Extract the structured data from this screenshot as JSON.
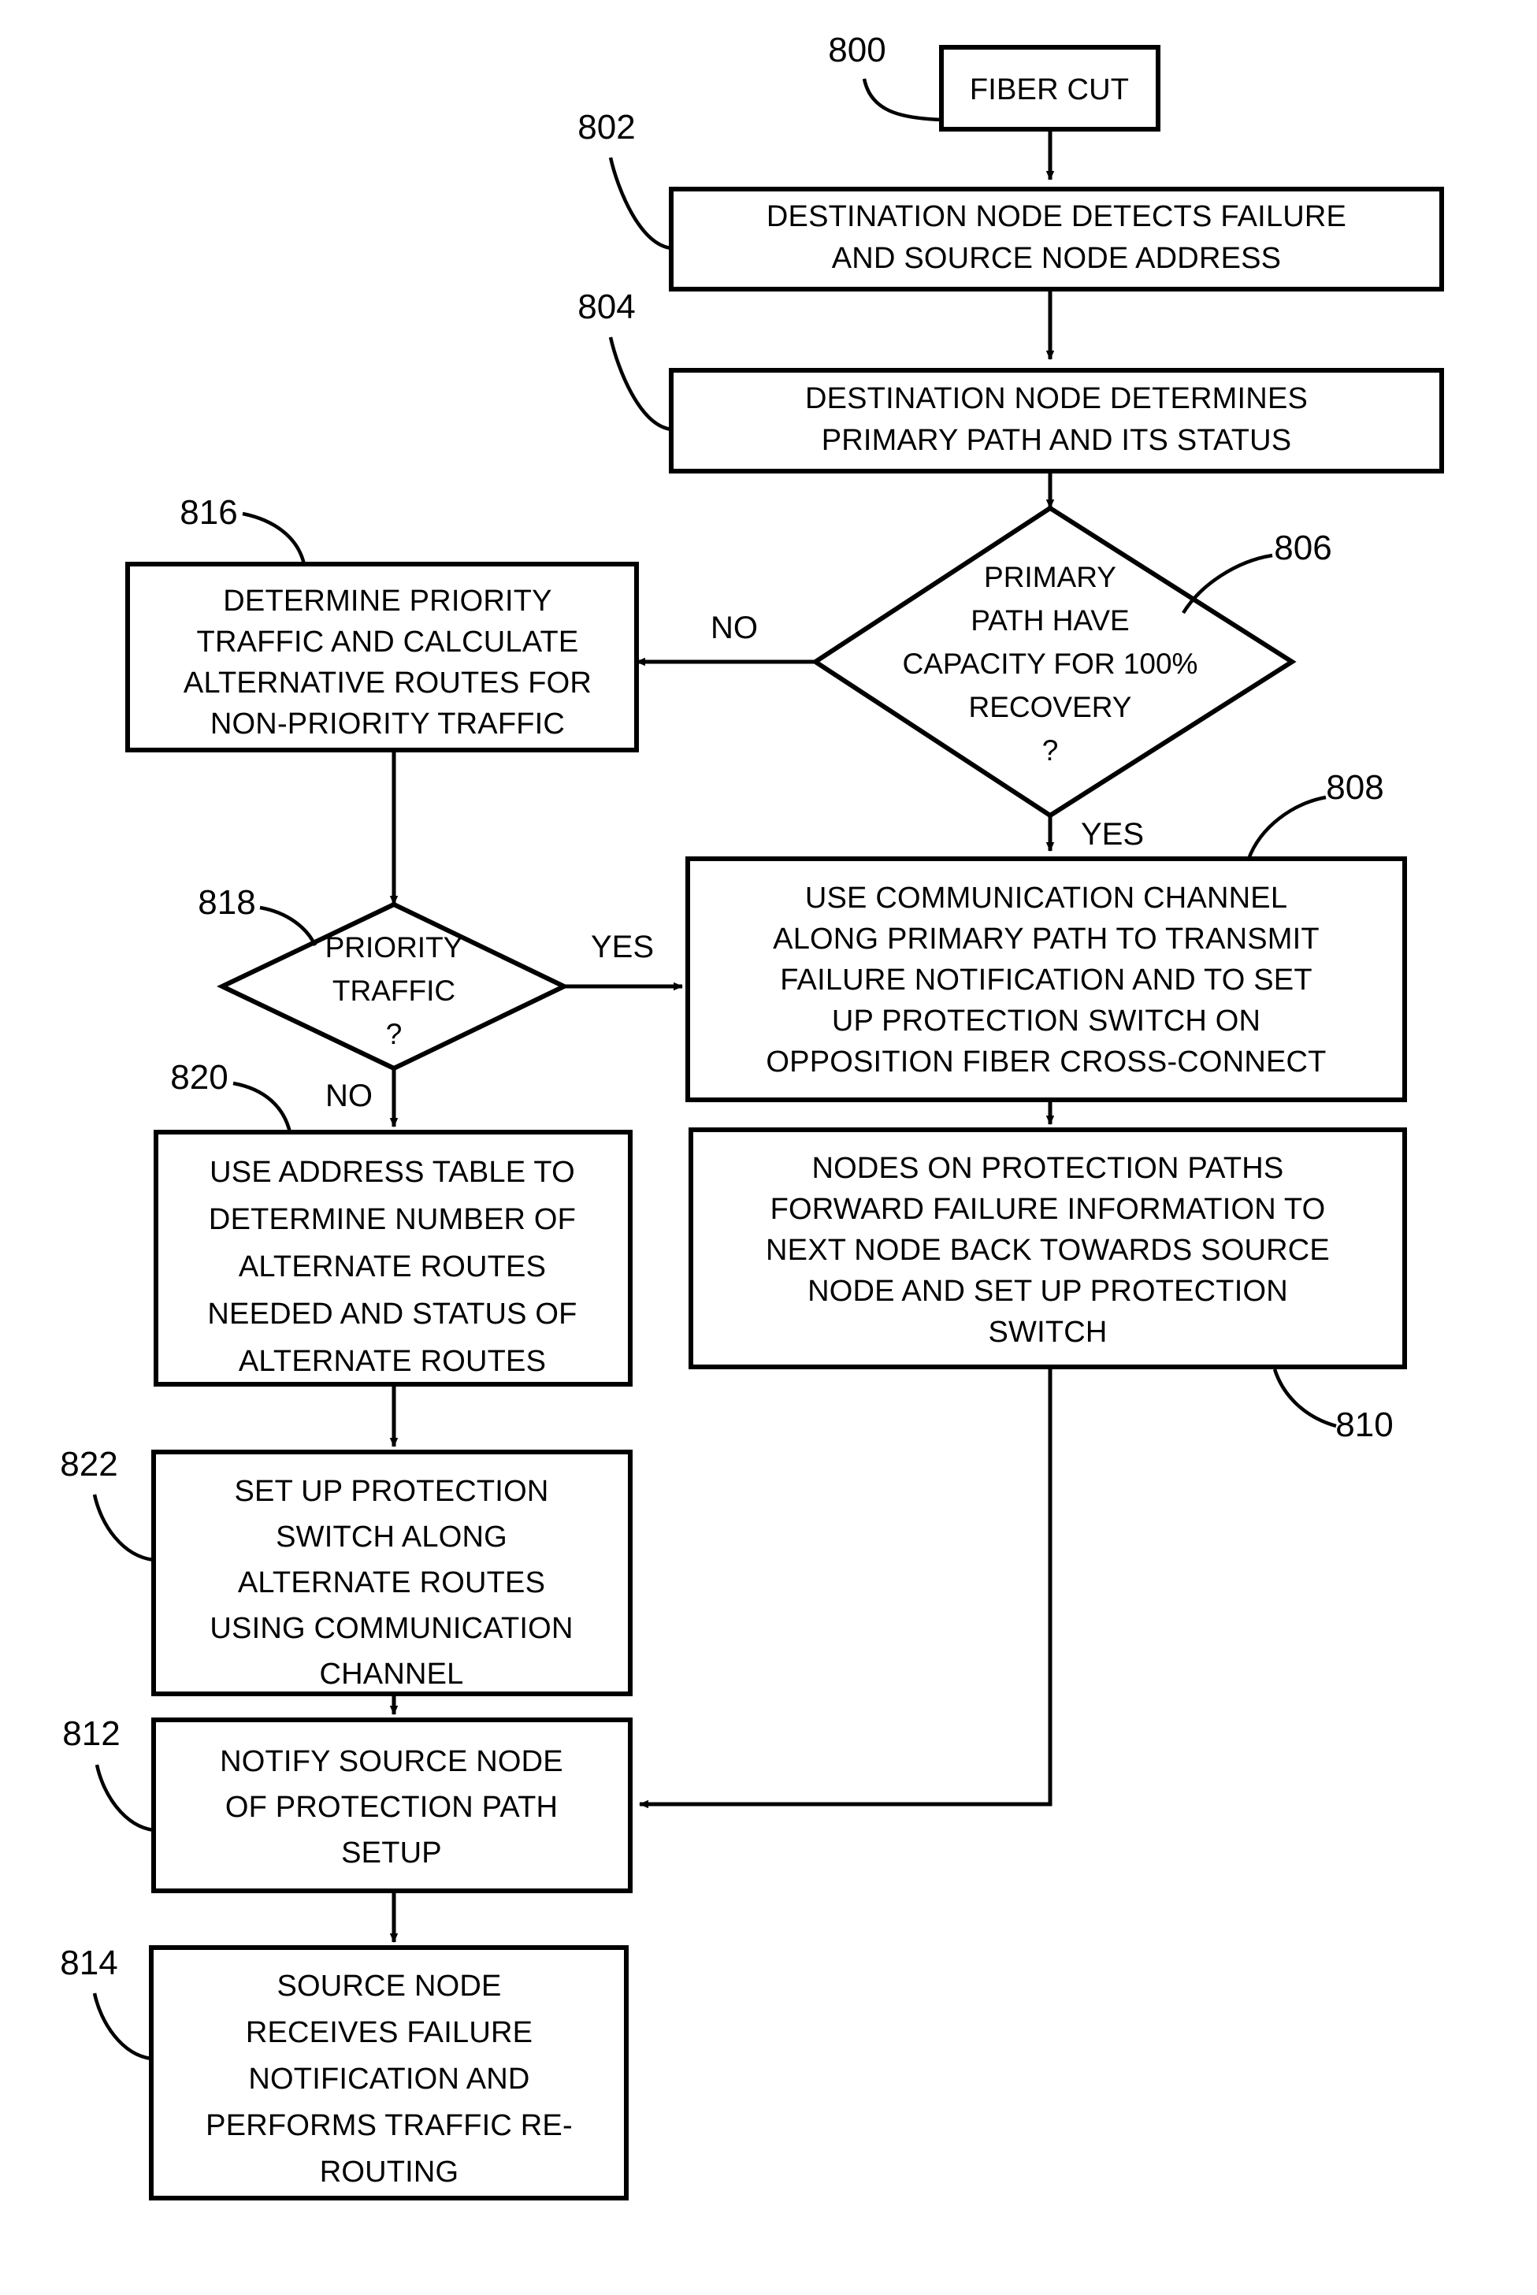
{
  "figure": {
    "type": "flowchart",
    "title": "Fiber cut protection switching flowchart",
    "colors": {
      "line": "#000000",
      "fill": "#ffffff",
      "background": "#ffffff"
    }
  },
  "nodes": [
    {
      "ref": "800",
      "shape": "process",
      "lines": [
        "FIBER CUT"
      ]
    },
    {
      "ref": "802",
      "shape": "process",
      "lines": [
        "DESTINATION NODE DETECTS FAILURE",
        "AND SOURCE NODE ADDRESS"
      ]
    },
    {
      "ref": "804",
      "shape": "process",
      "lines": [
        "DESTINATION NODE DETERMINES",
        "PRIMARY PATH AND ITS STATUS"
      ]
    },
    {
      "ref": "806",
      "shape": "decision",
      "lines": [
        "PRIMARY",
        "PATH HAVE",
        "CAPACITY FOR 100%",
        "RECOVERY",
        "?"
      ]
    },
    {
      "ref": "808",
      "shape": "process",
      "lines": [
        "USE COMMUNICATION CHANNEL",
        "ALONG PRIMARY PATH TO TRANSMIT",
        "FAILURE NOTIFICATION AND TO SET",
        "UP PROTECTION SWITCH ON",
        "OPPOSITION FIBER CROSS-CONNECT"
      ]
    },
    {
      "ref": "810",
      "shape": "process",
      "lines": [
        "NODES ON PROTECTION PATHS",
        "FORWARD FAILURE INFORMATION TO",
        "NEXT NODE BACK TOWARDS SOURCE",
        "NODE AND SET UP PROTECTION",
        "SWITCH"
      ]
    },
    {
      "ref": "812",
      "shape": "process",
      "lines": [
        "NOTIFY SOURCE NODE",
        "OF PROTECTION PATH",
        "SETUP"
      ]
    },
    {
      "ref": "814",
      "shape": "process",
      "lines": [
        "SOURCE NODE",
        "RECEIVES FAILURE",
        "NOTIFICATION AND",
        "PERFORMS TRAFFIC RE-",
        "ROUTING"
      ]
    },
    {
      "ref": "816",
      "shape": "process",
      "lines": [
        "DETERMINE PRIORITY",
        "TRAFFIC AND CALCULATE",
        "ALTERNATIVE ROUTES FOR",
        "NON-PRIORITY TRAFFIC"
      ]
    },
    {
      "ref": "818",
      "shape": "decision",
      "lines": [
        "PRIORITY",
        "TRAFFIC",
        "?"
      ]
    },
    {
      "ref": "820",
      "shape": "process",
      "lines": [
        "USE ADDRESS TABLE TO",
        "DETERMINE NUMBER OF",
        "ALTERNATE ROUTES",
        "NEEDED AND STATUS OF",
        "ALTERNATE ROUTES"
      ]
    },
    {
      "ref": "822",
      "shape": "process",
      "lines": [
        "SET UP PROTECTION",
        "SWITCH ALONG",
        "ALTERNATE ROUTES",
        "USING COMMUNICATION",
        "CHANNEL"
      ]
    }
  ],
  "edge_labels": {
    "decision_806_no": "NO",
    "decision_806_yes": "YES",
    "decision_818_yes": "YES",
    "decision_818_no": "NO"
  },
  "text": {
    "n800_l0": "FIBER CUT",
    "n802_l0": "DESTINATION NODE DETECTS FAILURE",
    "n802_l1": "AND SOURCE NODE ADDRESS",
    "n804_l0": "DESTINATION NODE DETERMINES",
    "n804_l1": "PRIMARY PATH AND ITS STATUS",
    "n806_l0": "PRIMARY",
    "n806_l1": "PATH HAVE",
    "n806_l2": "CAPACITY FOR 100%",
    "n806_l3": "RECOVERY",
    "n806_l4": "?",
    "n808_l0": "USE COMMUNICATION CHANNEL",
    "n808_l1": "ALONG PRIMARY PATH TO TRANSMIT",
    "n808_l2": "FAILURE NOTIFICATION AND TO SET",
    "n808_l3": "UP PROTECTION SWITCH ON",
    "n808_l4": "OPPOSITION FIBER CROSS-CONNECT",
    "n810_l0": "NODES ON PROTECTION PATHS",
    "n810_l1": "FORWARD FAILURE INFORMATION TO",
    "n810_l2": "NEXT NODE BACK TOWARDS SOURCE",
    "n810_l3": "NODE AND SET UP PROTECTION",
    "n810_l4": "SWITCH",
    "n812_l0": "NOTIFY SOURCE NODE",
    "n812_l1": "OF PROTECTION PATH",
    "n812_l2": "SETUP",
    "n814_l0": "SOURCE NODE",
    "n814_l1": "RECEIVES FAILURE",
    "n814_l2": "NOTIFICATION AND",
    "n814_l3": "PERFORMS TRAFFIC RE-",
    "n814_l4": "ROUTING",
    "n816_l0": "DETERMINE PRIORITY",
    "n816_l1": "TRAFFIC AND CALCULATE",
    "n816_l2": "ALTERNATIVE ROUTES FOR",
    "n816_l3": "NON-PRIORITY TRAFFIC",
    "n818_l0": "PRIORITY",
    "n818_l1": "TRAFFIC",
    "n818_l2": "?",
    "n820_l0": "USE ADDRESS TABLE TO",
    "n820_l1": "DETERMINE NUMBER OF",
    "n820_l2": "ALTERNATE ROUTES",
    "n820_l3": "NEEDED AND STATUS OF",
    "n820_l4": "ALTERNATE ROUTES",
    "n822_l0": "SET UP PROTECTION",
    "n822_l1": "SWITCH ALONG",
    "n822_l2": "ALTERNATE ROUTES",
    "n822_l3": "USING COMMUNICATION",
    "n822_l4": "CHANNEL",
    "ref800": "800",
    "ref802": "802",
    "ref804": "804",
    "ref806": "806",
    "ref808": "808",
    "ref810": "810",
    "ref812": "812",
    "ref814": "814",
    "ref816": "816",
    "ref818": "818",
    "ref820": "820",
    "ref822": "822",
    "lbl_no_806": "NO",
    "lbl_yes_806": "YES",
    "lbl_yes_818": "YES",
    "lbl_no_818": "NO"
  }
}
